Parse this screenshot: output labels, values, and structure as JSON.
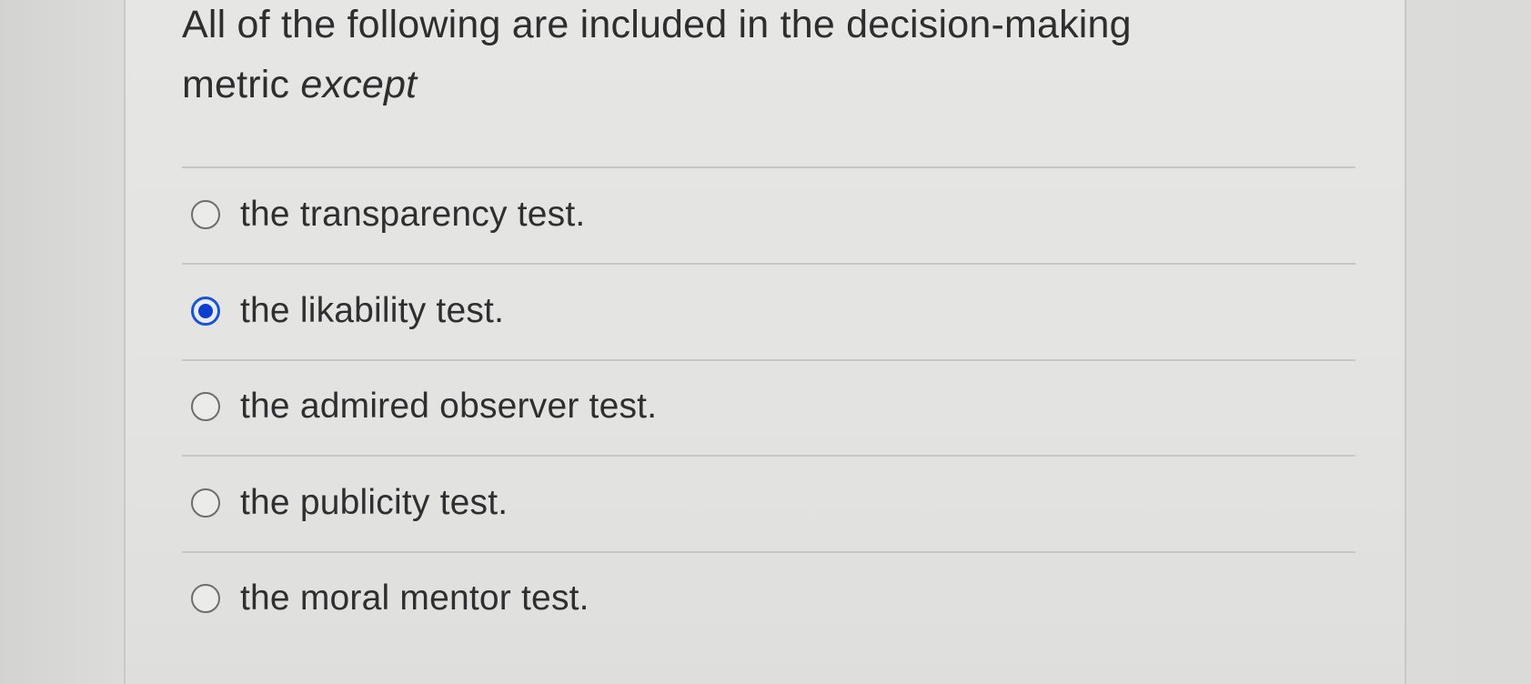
{
  "question": {
    "text_main": "All of the following are included in the decision-making metric",
    "text_emphasis": "except"
  },
  "answers": [
    {
      "label": "the transparency test.",
      "selected": false
    },
    {
      "label": "the likability test.",
      "selected": true
    },
    {
      "label": "the admired observer test.",
      "selected": false
    },
    {
      "label": "the publicity test.",
      "selected": false
    },
    {
      "label": "the moral mentor test.",
      "selected": false
    }
  ],
  "colors": {
    "selected_radio": "#0b3fcf",
    "text": "#2f2f32",
    "background": "#e3e3e1"
  }
}
